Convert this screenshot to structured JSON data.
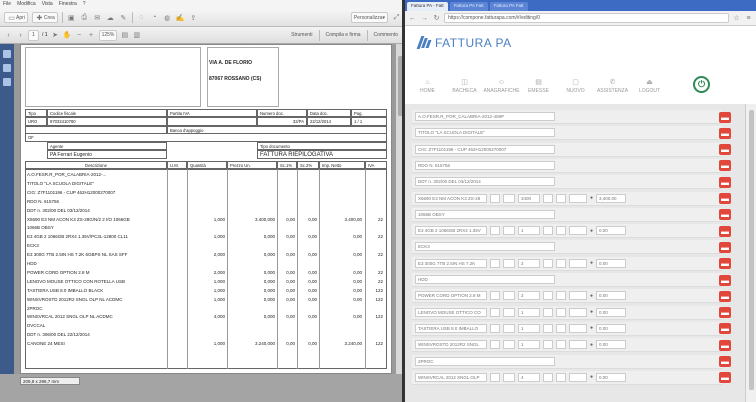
{
  "left": {
    "menubar": [
      "File",
      "Modifica",
      "Vista",
      "Finestra",
      "?"
    ],
    "toolbar1": {
      "apri": "Apri",
      "crea": "Crea",
      "personalizza": "Personalizza"
    },
    "toolbar2": {
      "page": "1",
      "of": "/ 1",
      "zoom": "125%",
      "strumenti": "Strumenti",
      "compila": "Compila e firma",
      "commento": "Commento"
    },
    "doc": {
      "addr1": "VIA A. DE FLORIO",
      "addr2": "87067 ROSSANO (CS)",
      "h_tipo": "Tipo",
      "h_cod": "Codice fiscale",
      "h_piva": "Partita IVA",
      "h_num": "Numero doc.",
      "h_data": "Data doc.",
      "h_pag": "Pag.",
      "v_tipo": "URO",
      "v_cod": "97032410780",
      "v_num": "32/PA",
      "v_data": "22/12/2014",
      "v_pag": "1 / 1",
      "banca": "Banca d'appoggio",
      "of": "OF",
      "agente": "Agente",
      "agente_val": "PA   Ferrari Eugenio",
      "tipo_doc": "Tipo documento",
      "tipo_doc_val": "FATTURA RIEPILOGATIVA",
      "col_desc": "Descrizione",
      "col_um": "U.M.",
      "col_qta": "Quantità",
      "col_prezzo": "Prezzo Un.",
      "col_sc1": "Sc.1%",
      "col_sc2": "Sc.2%",
      "col_imp": "Imp. Netto",
      "col_iva": "IVA"
    },
    "items": [
      {
        "d": "A.O.FESR.R_POR_CALABRIA-2012-...",
        "q": "",
        "p": "",
        "s1": "",
        "s2": "",
        "i": "",
        "v": ""
      },
      {
        "d": "TITOLO \"LA SCUOLA DIGITALE\"",
        "q": "",
        "p": "",
        "s1": "",
        "s2": "",
        "i": "",
        "v": ""
      },
      {
        "d": "CIG: Z7F1101196 - CUP 462H12000270007",
        "q": "",
        "p": "",
        "s1": "",
        "s2": "",
        "i": "",
        "v": ""
      },
      {
        "d": "RDO N. 615756",
        "q": "",
        "p": "",
        "s1": "",
        "s2": "",
        "i": "",
        "v": ""
      },
      {
        "d": "DDT n. 302/00 DEL 03/12/2014",
        "q": "",
        "p": "",
        "s1": "",
        "s2": "",
        "i": "",
        "v": ""
      },
      {
        "d": "X5690 E3 NM ACON K3 ZS-28G/N/2 2 I/O 1066GB",
        "q": "1,000",
        "p": "3.400,000",
        "s1": "0,00",
        "s2": "0,00",
        "i": "3.400,00",
        "v": "22"
      },
      {
        "d": "1066B OBSY",
        "q": "",
        "p": "",
        "s1": "",
        "s2": "",
        "i": "",
        "v": ""
      },
      {
        "d": "E3 4GB 2 1066GB 2RX4 1.35V/PC3L-12800 CL11",
        "q": "1,000",
        "p": "0,000",
        "s1": "0,00",
        "s2": "0,00",
        "i": "0,00",
        "v": "22"
      },
      {
        "d": "ECK3",
        "q": "",
        "p": "",
        "s1": "",
        "s2": "",
        "i": "",
        "v": ""
      },
      {
        "d": "E3 300G 7TB 2.5IN HS 7.2K 6GBPS NL SAS SFF",
        "q": "2,000",
        "p": "0,000",
        "s1": "0,00",
        "s2": "0,00",
        "i": "0,00",
        "v": "22"
      },
      {
        "d": "HDD",
        "q": "",
        "p": "",
        "s1": "",
        "s2": "",
        "i": "",
        "v": ""
      },
      {
        "d": "POWER CORD OPTION 2.8 M",
        "q": "2,000",
        "p": "0,000",
        "s1": "0,00",
        "s2": "0,00",
        "i": "0,00",
        "v": "22"
      },
      {
        "d": "LENOVO MOUSE OTTICO CON ROTELLA USB",
        "q": "1,000",
        "p": "0,000",
        "s1": "0,00",
        "s2": "0,00",
        "i": "0,00",
        "v": "22"
      },
      {
        "d": "TASTIERA USB 8.0 IMBALLO BLACK",
        "q": "1,000",
        "p": "0,000",
        "s1": "0,00",
        "s2": "0,00",
        "i": "0,00",
        "v": "122"
      },
      {
        "d": "WINSVROSTD 2012R2 SNGL OLP NL ACDMC",
        "q": "1,000",
        "p": "0,000",
        "s1": "0,00",
        "s2": "0,00",
        "i": "0,00",
        "v": "122"
      },
      {
        "d": "2PROC",
        "q": "",
        "p": "",
        "s1": "",
        "s2": "",
        "i": "",
        "v": ""
      },
      {
        "d": "WINSVRCAL 2012 SNGL OLP NL ACDMC",
        "q": "4,000",
        "p": "0,000",
        "s1": "0,00",
        "s2": "0,00",
        "i": "0,00",
        "v": "122"
      },
      {
        "d": "DVCCAL",
        "q": "",
        "p": "",
        "s1": "",
        "s2": "",
        "i": "",
        "v": ""
      },
      {
        "d": "DDT n. 306/00 DEL 22/12/2014",
        "q": "",
        "p": "",
        "s1": "",
        "s2": "",
        "i": "",
        "v": ""
      },
      {
        "d": "CANONE 24 MESI",
        "q": "1,000",
        "p": "3.240,000",
        "s1": "0,00",
        "s2": "0,00",
        "i": "3.240,00",
        "v": "122"
      }
    ],
    "pagesize": "209,9 x 296,7 mm"
  },
  "right": {
    "tabs": [
      "Fattura PA - Fatt",
      "Fattura PA Fatt",
      "Fattura PA Fatt"
    ],
    "url": "https://compone.fatturapa.com/#/editing/0",
    "logo": "FATTURA PA",
    "nav": [
      "HOME",
      "BACHECA",
      "ANAGRAFICHE",
      "EMESSE",
      "NUOVO",
      "ASSISTENZA",
      "LOGOUT"
    ],
    "rows": [
      {
        "label": "A.O.FESR.R_POR_CALABRIA-2012-408P",
        "extra": false
      },
      {
        "label": "TITOLO \"LA SCUOLA DIGITALE\"",
        "extra": false
      },
      {
        "label": "CIG: Z7F1101196 - CUP 462H12000270007",
        "extra": false
      },
      {
        "label": "RDO N. 615756",
        "extra": false
      },
      {
        "label": "DDT n. 302/00 DEL 03/12/2014",
        "extra": false
      },
      {
        "label": "X5690 E3 NM ACON K3 ZS-28",
        "extra": true,
        "q": "3400",
        "v": "3,400.00"
      },
      {
        "label": "1066B OBSY",
        "extra": false
      },
      {
        "label": "E3 4GB 2 1066GB 2RX4 1.35V",
        "extra": true,
        "q": "1",
        "v": "0.00"
      },
      {
        "label": "ECK3",
        "extra": false
      },
      {
        "label": "E3 300G 7TB 2.5IN HS 7.2K",
        "extra": true,
        "q": "2",
        "v": "0.00"
      },
      {
        "label": "HDD",
        "extra": false
      },
      {
        "label": "POWER CORD OPTION 2.8 M",
        "extra": true,
        "q": "2",
        "v": "0.00"
      },
      {
        "label": "LENOVO MOUSE OTTICO CO",
        "extra": true,
        "q": "1",
        "v": "0.00"
      },
      {
        "label": "TASTIERA USB 8.0 IMBALLO",
        "extra": true,
        "q": "1",
        "v": "0.00"
      },
      {
        "label": "WINSVROSTD 2012R2 SNGL",
        "extra": true,
        "q": "1",
        "v": "0.00"
      },
      {
        "label": "2PROC",
        "extra": false
      },
      {
        "label": "WINSVRCAL 2012 SNGL OLP",
        "extra": true,
        "q": "4",
        "v": "0.00"
      }
    ],
    "colors": {
      "accent": "#4a7fc1",
      "delete": "#e2473b",
      "power": "#2e8b57"
    }
  }
}
